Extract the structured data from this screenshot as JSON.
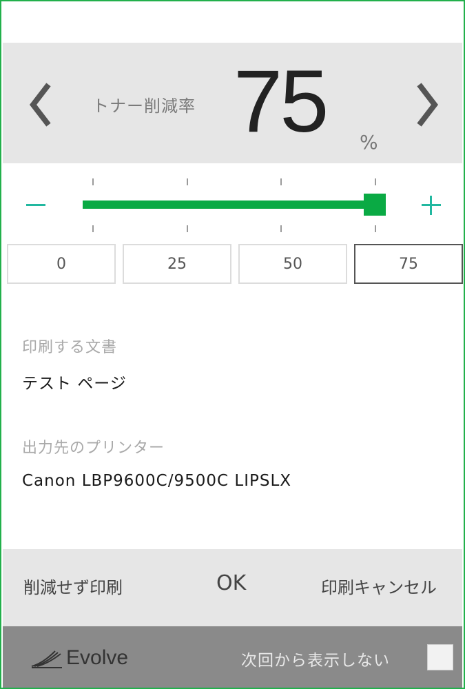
{
  "header": {
    "label": "トナー削減率",
    "value": "75",
    "unit": "%",
    "prev_icon": "chevron-left-icon",
    "next_icon": "chevron-right-icon"
  },
  "slider": {
    "value": 75,
    "min": 0,
    "max": 75,
    "accent_color": "#0aaa44",
    "minus_icon": "minus-icon",
    "plus_icon": "plus-icon"
  },
  "presets": [
    {
      "label": "0",
      "selected": false
    },
    {
      "label": "25",
      "selected": false
    },
    {
      "label": "50",
      "selected": false
    },
    {
      "label": "75",
      "selected": true
    }
  ],
  "document": {
    "label": "印刷する文書",
    "value": "テスト ページ"
  },
  "printer": {
    "label": "出力先のプリンター",
    "value": "Canon LBP9600C/9500C LIPSLX"
  },
  "actions": {
    "print_without_reduction": "削減せず印刷",
    "ok": "OK",
    "cancel_print": "印刷キャンセル"
  },
  "footer": {
    "brand": "Evolve",
    "dont_show_again": "次回から表示しない",
    "dont_show_checked": false
  }
}
